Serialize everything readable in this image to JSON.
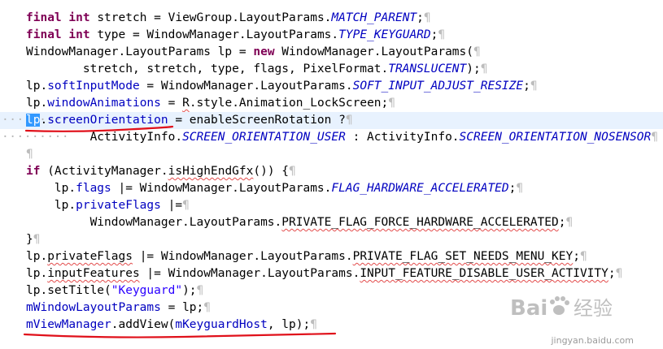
{
  "editor": {
    "pilcrow": "¶",
    "dots": "·········",
    "lines": [
      {
        "segs": [
          {
            "t": "final",
            "c": "kw"
          },
          {
            "t": " "
          },
          {
            "t": "int",
            "c": "kw"
          },
          {
            "t": " stretch = ViewGroup.LayoutParams."
          },
          {
            "t": "MATCH_PARENT",
            "c": "cst"
          },
          {
            "t": ";"
          }
        ]
      },
      {
        "segs": [
          {
            "t": "final",
            "c": "kw"
          },
          {
            "t": " "
          },
          {
            "t": "int",
            "c": "kw"
          },
          {
            "t": " type = WindowManager.LayoutParams."
          },
          {
            "t": "TYPE_KEYGUARD",
            "c": "cst"
          },
          {
            "t": ";"
          }
        ]
      },
      {
        "segs": [
          {
            "t": "WindowManager.LayoutParams lp = "
          },
          {
            "t": "new",
            "c": "kw"
          },
          {
            "t": " WindowManager.LayoutParams("
          }
        ]
      },
      {
        "segs": [
          {
            "t": "        stretch, stretch, type, flags, PixelFormat."
          },
          {
            "t": "TRANSLUCENT",
            "c": "cst"
          },
          {
            "t": ");"
          }
        ]
      },
      {
        "segs": [
          {
            "t": "lp."
          },
          {
            "t": "softInputMode",
            "c": "fld"
          },
          {
            "t": " = WindowManager.LayoutParams."
          },
          {
            "t": "SOFT_INPUT_ADJUST_RESIZE",
            "c": "cst"
          },
          {
            "t": ";"
          }
        ]
      },
      {
        "segs": [
          {
            "t": "lp."
          },
          {
            "t": "windowAnimations",
            "c": "fld"
          },
          {
            "t": " = "
          },
          {
            "t": "R",
            "c": "sq"
          },
          {
            "t": ".style.Animation_LockScreen;"
          }
        ]
      },
      {
        "segs": [
          {
            "t": "lp",
            "c": "sel"
          },
          {
            "t": "."
          },
          {
            "t": "screenOrientation",
            "c": "fld"
          },
          {
            "t": " = enableScreenRotation ?"
          }
        ]
      },
      {
        "segs": [
          {
            "t": "         ActivityInfo."
          },
          {
            "t": "SCREEN_ORIENTATION_USER",
            "c": "cst"
          },
          {
            "t": " : ActivityInfo."
          },
          {
            "t": "SCREEN_ORIENTATION_NOSENSOR",
            "c": "cst"
          }
        ]
      },
      {
        "segs": []
      },
      {
        "segs": [
          {
            "t": "if",
            "c": "kw"
          },
          {
            "t": " (ActivityManager."
          },
          {
            "t": "isHighEndGfx",
            "c": "sq"
          },
          {
            "t": "()) {"
          }
        ]
      },
      {
        "segs": [
          {
            "t": "    lp."
          },
          {
            "t": "flags",
            "c": "fld"
          },
          {
            "t": " |= WindowManager.LayoutParams."
          },
          {
            "t": "FLAG_HARDWARE_ACCELERATED",
            "c": "cst"
          },
          {
            "t": ";"
          }
        ]
      },
      {
        "segs": [
          {
            "t": "    lp."
          },
          {
            "t": "privateFlags",
            "c": "fld"
          },
          {
            "t": " |="
          }
        ]
      },
      {
        "segs": [
          {
            "t": "         WindowManager.LayoutParams."
          },
          {
            "t": "PRIVATE_FLAG_FORCE_HARDWARE_ACCELERATED",
            "c": "sq"
          },
          {
            "t": ";"
          }
        ]
      },
      {
        "segs": [
          {
            "t": "}"
          }
        ]
      },
      {
        "segs": [
          {
            "t": "lp."
          },
          {
            "t": "privateFlags",
            "c": "sq"
          },
          {
            "t": " |= WindowManager.LayoutParams."
          },
          {
            "t": "PRIVATE_FLAG_SET_NEEDS_MENU_KEY",
            "c": "sq"
          },
          {
            "t": ";"
          }
        ]
      },
      {
        "segs": [
          {
            "t": "lp."
          },
          {
            "t": "inputFeatures",
            "c": "sq"
          },
          {
            "t": " |= WindowManager.LayoutParams."
          },
          {
            "t": "INPUT_FEATURE_DISABLE_USER_ACTIVITY",
            "c": "sq"
          },
          {
            "t": ";"
          }
        ]
      },
      {
        "segs": [
          {
            "t": "lp.setTitle("
          },
          {
            "t": "\"Keyguard\"",
            "c": "str"
          },
          {
            "t": ");"
          }
        ]
      },
      {
        "segs": [
          {
            "t": "mWindowLayoutParams",
            "c": "fld"
          },
          {
            "t": " = lp;"
          }
        ]
      },
      {
        "segs": [
          {
            "t": "mViewManager",
            "c": "fld"
          },
          {
            "t": ".addView("
          },
          {
            "t": "mKeyguardHost",
            "c": "fld"
          },
          {
            "t": ", lp);"
          }
        ]
      }
    ]
  },
  "watermark": {
    "brand": "Bai",
    "brand_cn": "经验",
    "url": "jingyan.baidu.com",
    "color": "#8c8c8c"
  },
  "colors": {
    "keyword": "#7f0055",
    "field": "#0000c0",
    "string": "#2a00ff",
    "annotation_line": "#e0101a",
    "selection": "#3399ff",
    "current_line": "#e8f2fe"
  }
}
